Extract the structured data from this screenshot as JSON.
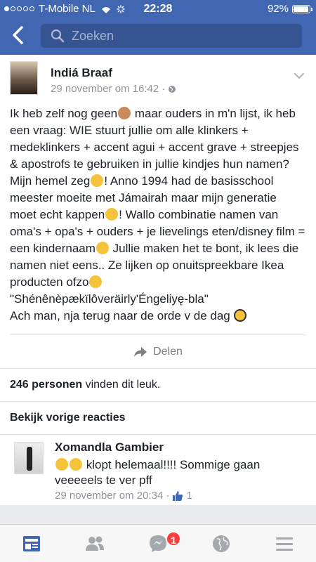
{
  "status_bar": {
    "carrier": "T-Mobile NL",
    "time": "22:28",
    "battery": "92%"
  },
  "nav": {
    "search_placeholder": "Zoeken"
  },
  "post": {
    "author": "Indiá Braaf",
    "timestamp": "29 november om 16:42 ·",
    "text_parts": [
      "Ik heb zelf nog geen",
      " maar ouders in m'n lijst, ik heb een vraag: WIE stuurt jullie om alle klinkers + medeklinkers + accent agui + accent grave + streepjes & apostrofs te gebruiken in jullie kindjes hun namen? Mijn hemel zeg",
      "! Anno 1994 had de basisschool meester moeite met Jámairah maar mijn generatie moet echt kappen",
      "! Wallo combinatie namen van oma's + opa's + ouders + je lievelings eten/disney film = een kindernaam",
      " Jullie maken het te bont, ik lees die namen niet eens.. Ze lijken op onuitspreekbare Ikea producten ofzo",
      "\n\"Shénênèpækïlôveräirly'Éngeliyę-bla\"\nAch man, nja terug naar de orde v de dag "
    ],
    "share_label": "Delen"
  },
  "likes": {
    "count": "246 personen",
    "suffix": " vinden dit leuk."
  },
  "previous_comments": "Bekijk vorige reacties",
  "comment": {
    "author": "Xomandla Gambier",
    "text": " klopt helemaal!!!! Sommige gaan veeeeels te ver pff",
    "timestamp": "29 november om 20:34 ·",
    "like_count": "1"
  },
  "tabbar": {
    "messenger_badge": "1"
  },
  "colors": {
    "brand": "#4267b2",
    "badge": "#fa3e3e"
  }
}
